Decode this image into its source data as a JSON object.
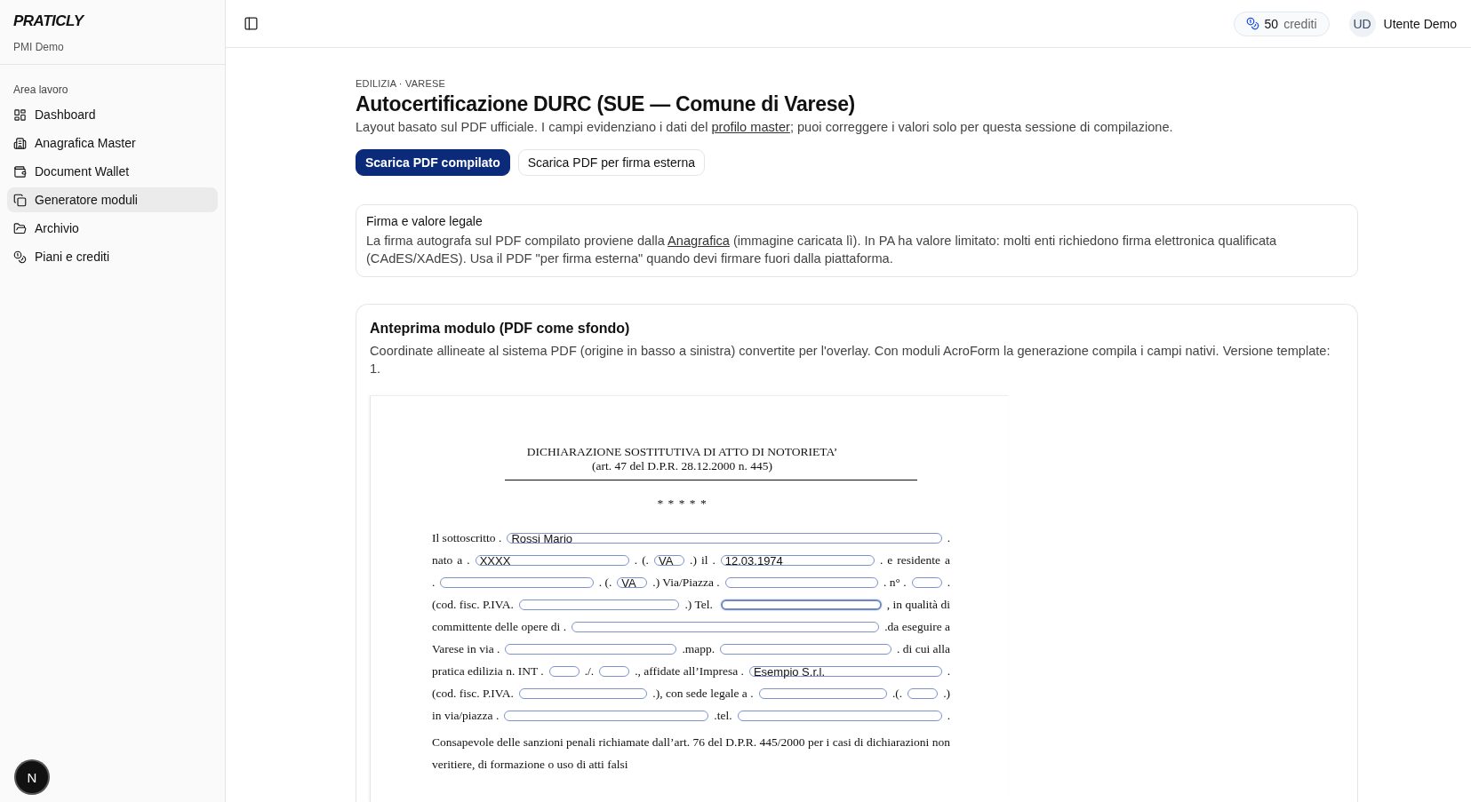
{
  "sidebar": {
    "logo": "PRATICLY",
    "workspace": "PMI Demo",
    "section_label": "Area lavoro",
    "items": [
      {
        "label": "Dashboard",
        "selected": false
      },
      {
        "label": "Anagrafica Master",
        "selected": false
      },
      {
        "label": "Document Wallet",
        "selected": false
      },
      {
        "label": "Generatore moduli",
        "selected": true
      },
      {
        "label": "Archivio",
        "selected": false
      },
      {
        "label": "Piani e crediti",
        "selected": false
      }
    ],
    "dev_badge": "N"
  },
  "header": {
    "credits_count": "50",
    "credits_label": "crediti",
    "avatar": "UD",
    "user_name": "Utente Demo"
  },
  "page": {
    "breadcrumb": "EDILIZIA · VARESE",
    "title": "Autocertificazione DURC (SUE — Comune di Varese)",
    "subtitle": "Layout basato sul PDF ufficiale. I campi evidenziano i dati del ",
    "subtitle_link": "profilo master",
    "subtitle_end": "; puoi correggere i valori solo per questa sessione di compilazione.",
    "buttons": [
      {
        "label": "Scarica PDF compilato",
        "kind": "primary"
      },
      {
        "label": "Scarica PDF per firma esterna",
        "kind": "outline"
      }
    ]
  },
  "notice": {
    "title": "Firma e valore legale",
    "text_start": "La firma autografa sul PDF compilato proviene dalla ",
    "link": "Anagrafica",
    "text_end": " (immagine caricata lì). In PA ha valore limitato: molti enti richiedono firma elettronica qualificata (CAdES/XAdES). Usa il PDF \"per firma esterna\" quando devi firmare fuori dalla piattaforma."
  },
  "preview": {
    "title": "Anteprima modulo (PDF come sfondo)",
    "description": "Coordinate allineate al sistema PDF (origine in basso a sinistra) convertite per l'overlay. Con moduli AcroForm la generazione compila i campi nativi. Versione template: 1.",
    "document": {
      "heading": "DICHIARAZIONE SOSTITUTIVA DI ATTO DI NOTORIETA’",
      "subheading": "(art. 47 del D.P.R. 28.12.2000 n. 445)",
      "separator": "* * * * *",
      "lines": [
        [
          {
            "kind": "text",
            "text": "Il sottoscritto ."
          },
          {
            "kind": "field",
            "value": "Rossi Mario",
            "focused": false
          },
          {
            "kind": "text",
            "text": "."
          }
        ],
        [
          {
            "kind": "text",
            "text": "nato"
          },
          {
            "kind": "text",
            "text": "a"
          },
          {
            "kind": "text",
            "text": "."
          },
          {
            "kind": "field",
            "value": "XXXX",
            "focused": false
          },
          {
            "kind": "text",
            "text": "."
          },
          {
            "kind": "text",
            "text": "(."
          },
          {
            "kind": "small_field",
            "value": "VA",
            "focused": false
          },
          {
            "kind": "text",
            "text": ".)"
          },
          {
            "kind": "text",
            "text": "il"
          },
          {
            "kind": "text",
            "text": "."
          },
          {
            "kind": "field",
            "value": "12.03.1974",
            "focused": false
          },
          {
            "kind": "text",
            "text": "."
          },
          {
            "kind": "text",
            "text": "e"
          },
          {
            "kind": "text",
            "text": "residente"
          },
          {
            "kind": "text",
            "text": "a"
          }
        ],
        [
          {
            "kind": "text",
            "text": "."
          },
          {
            "kind": "field",
            "focused": false
          },
          {
            "kind": "text",
            "text": ". (."
          },
          {
            "kind": "small_field",
            "value": "VA",
            "focused": false
          },
          {
            "kind": "text",
            "text": ".) Via/Piazza ."
          },
          {
            "kind": "field",
            "focused": false
          },
          {
            "kind": "text",
            "text": ". n° ."
          },
          {
            "kind": "small_field",
            "focused": false
          },
          {
            "kind": "text",
            "text": "."
          }
        ],
        [
          {
            "kind": "text",
            "text": "(cod. fisc. P.IVA."
          },
          {
            "kind": "field",
            "focused": false
          },
          {
            "kind": "text",
            "text": ".) Tel. "
          },
          {
            "kind": "field",
            "focused": true
          },
          {
            "kind": "text",
            "text": ", in qualità di"
          }
        ],
        [
          {
            "kind": "text",
            "text": "committente delle opere di ."
          },
          {
            "kind": "field",
            "focused": false
          },
          {
            "kind": "text",
            "text": ".da eseguire a"
          }
        ],
        [
          {
            "kind": "text",
            "text": "Varese in via ."
          },
          {
            "kind": "field",
            "focused": false
          },
          {
            "kind": "text",
            "text": ".mapp."
          },
          {
            "kind": "field",
            "focused": false
          },
          {
            "kind": "text",
            "text": ". di cui alla"
          }
        ],
        [
          {
            "kind": "text",
            "text": "pratica edilizia n. INT ."
          },
          {
            "kind": "small_field",
            "focused": false
          },
          {
            "kind": "text",
            "text": "./."
          },
          {
            "kind": "small_field",
            "focused": false
          },
          {
            "kind": "text",
            "text": "., affidate all’Impresa ."
          },
          {
            "kind": "field",
            "value": "Esempio S.r.l.",
            "focused": false
          },
          {
            "kind": "text",
            "text": "."
          }
        ],
        [
          {
            "kind": "text",
            "text": "(cod. fisc. P.IVA."
          },
          {
            "kind": "field",
            "focused": false
          },
          {
            "kind": "text",
            "text": ".), con sede legale a ."
          },
          {
            "kind": "field",
            "focused": false
          },
          {
            "kind": "text",
            "text": ".(."
          },
          {
            "kind": "small_field",
            "focused": false
          },
          {
            "kind": "text",
            "text": ".)"
          }
        ],
        [
          {
            "kind": "text",
            "text": "in via/piazza ."
          },
          {
            "kind": "field",
            "focused": false
          },
          {
            "kind": "text",
            "text": ".tel."
          },
          {
            "kind": "field",
            "focused": false
          },
          {
            "kind": "text",
            "text": "."
          }
        ]
      ],
      "paragraph": "Consapevole delle sanzioni penali richiamate dall’art. 76 del D.P.R. 445/2000 per i casi di dichiarazioni non veritiere, di formazione o uso di atti falsi"
    }
  }
}
